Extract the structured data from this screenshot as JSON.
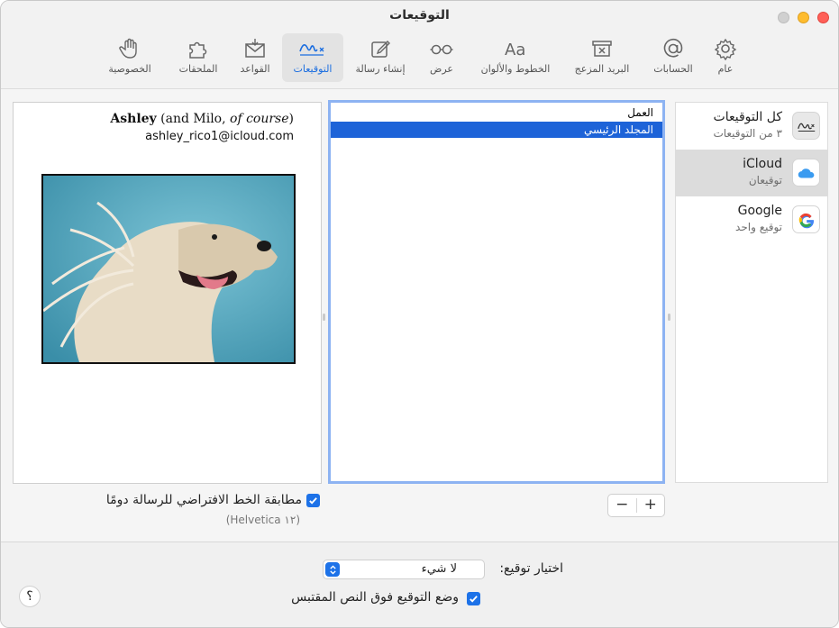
{
  "window": {
    "title": "التوقيعات"
  },
  "toolbar": {
    "items": [
      {
        "label": "عام",
        "icon": "gear-icon"
      },
      {
        "label": "الحسابات",
        "icon": "at-sign-icon"
      },
      {
        "label": "البريد المزعج",
        "icon": "junk-tray-icon"
      },
      {
        "label": "الخطوط والألوان",
        "icon": "fonts-icon"
      },
      {
        "label": "عرض",
        "icon": "glasses-icon"
      },
      {
        "label": "إنشاء رسالة",
        "icon": "compose-icon"
      },
      {
        "label": "التوقيعات",
        "icon": "signature-icon",
        "active": true
      },
      {
        "label": "القواعد",
        "icon": "rules-envelope-icon"
      },
      {
        "label": "الملحقات",
        "icon": "puzzle-icon"
      },
      {
        "label": "الخصوصية",
        "icon": "hand-icon"
      }
    ]
  },
  "accounts": [
    {
      "name": "كل التوقيعات",
      "sub": "٣ من التوقيعات",
      "icon": "all-signatures-icon"
    },
    {
      "name": "iCloud",
      "sub": "توقيعان",
      "icon": "icloud-icon",
      "selected": true
    },
    {
      "name": "Google",
      "sub": "توقيع واحد",
      "icon": "google-icon"
    }
  ],
  "signatures": [
    {
      "label": "العمل"
    },
    {
      "label": "المجلد الرئيسي",
      "selected": true
    }
  ],
  "preview": {
    "name_bold": "Ashley",
    "name_rest_1": " (and Milo, ",
    "name_italic": "of course",
    "name_rest_2": ")",
    "email": "ashley_rico1@icloud.com",
    "image": "dog-photo"
  },
  "controls": {
    "remove": "−",
    "add": "+",
    "match_font_label": "مطابقة الخط الافتراضي للرسالة دومًا",
    "match_font_checked": true,
    "font_info": "(Helvetica ١٢)"
  },
  "bottom": {
    "choose_label": "اختيار توقيع:",
    "choose_value": "لا شيء",
    "place_label": "وضع التوقيع فوق النص المقتبس",
    "place_checked": true,
    "help": "؟"
  },
  "colors": {
    "accent": "#1d72e8",
    "selection": "#1d63d8"
  }
}
